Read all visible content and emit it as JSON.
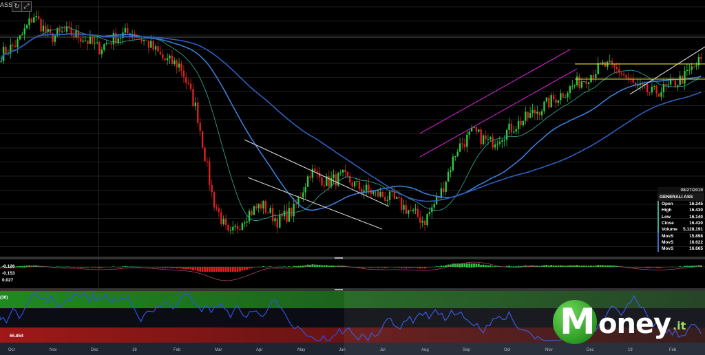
{
  "header": {
    "symbol_fragment": "ASS",
    "refresh_icon": "refresh-icon",
    "expand_icon": "expand-icon"
  },
  "colors": {
    "up": "#2ecc40",
    "down": "#e02020",
    "ma_teal": "#2f9e8f",
    "ma_blue_light": "#3a7fd8",
    "ma_blue_dark": "#2f5fc0",
    "channel_magenta": "#d020d0",
    "channel_white": "#d8d8d8",
    "level_yellow": "#e8e830",
    "osc_line": "#3050e0"
  },
  "info_panel": {
    "date": "08/27/2019",
    "name": "GENERALI ASS",
    "rows": [
      {
        "label": "Open",
        "value": "16.245"
      },
      {
        "label": "High",
        "value": "16.430"
      },
      {
        "label": "Low",
        "value": "16.140"
      },
      {
        "label": "Close",
        "value": "16.430"
      },
      {
        "label": "Volume",
        "value": "5,128,191"
      },
      {
        "label": "MovS",
        "value": "15.898"
      },
      {
        "label": "MovS",
        "value": "16.622"
      },
      {
        "label": "MovS",
        "value": "16.665"
      }
    ]
  },
  "macd_panel": {
    "labels": [
      "-0.126",
      "-0.153",
      "0.027"
    ]
  },
  "rsi_panel": {
    "period_label": "(30)",
    "value_label": "65.854"
  },
  "x_axis": {
    "months": [
      "Oct",
      "Nov",
      "Dec",
      "18",
      "Feb",
      "Mar",
      "Apr",
      "May",
      "Jun",
      "Jul",
      "Aug",
      "Sep",
      "Oct",
      "Nov",
      "Dec",
      "19",
      "Feb"
    ]
  },
  "logo": {
    "letter": "M",
    "rest": "oney",
    "tld": ".it"
  },
  "chart_data": {
    "type": "candlestick",
    "title": "GENERALI ASS",
    "ylim": [
      13.0,
      17.5
    ],
    "close_path": [
      16.6,
      16.8,
      17.3,
      16.9,
      17.0,
      16.9,
      16.7,
      16.9,
      17.0,
      16.8,
      16.5,
      16.4,
      15.6,
      14.0,
      13.3,
      13.7,
      13.9,
      13.6,
      13.8,
      14.5,
      14.3,
      14.4,
      14.2,
      14.1,
      14.0,
      13.8,
      13.6,
      14.1,
      14.9,
      15.2,
      15.0,
      15.2,
      15.4,
      15.6,
      15.8,
      16.0,
      16.2,
      16.4,
      16.3,
      16.0,
      15.9,
      16.0,
      16.2,
      16.5
    ],
    "moving_averages": [
      "MovS",
      "MovS",
      "MovS"
    ],
    "rsi_last": 65.854
  }
}
